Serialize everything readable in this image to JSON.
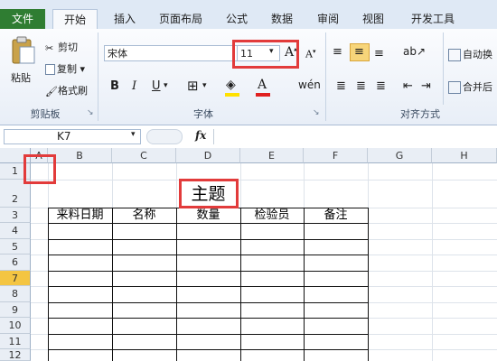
{
  "tabs": [
    {
      "label": "文件"
    },
    {
      "label": "开始"
    },
    {
      "label": "插入"
    },
    {
      "label": "页面布局"
    },
    {
      "label": "公式"
    },
    {
      "label": "数据"
    },
    {
      "label": "审阅"
    },
    {
      "label": "视图"
    },
    {
      "label": "开发工具"
    }
  ],
  "clipboard": {
    "paste_label": "粘贴",
    "cut_label": "剪切",
    "copy_label": "复制",
    "format_painter_label": "格式刷",
    "group_label": "剪贴板"
  },
  "font": {
    "name": "宋体",
    "size": "11",
    "group_label": "字体",
    "bold": "B",
    "italic": "I",
    "underline": "U"
  },
  "alignment": {
    "group_label": "对齐方式",
    "wrap_label": "自动换",
    "merge_label": "合并后"
  },
  "formula_bar": {
    "name_box": "K7",
    "fx": "fx",
    "content": ""
  },
  "columns": [
    "A",
    "B",
    "C",
    "D",
    "E",
    "F",
    "G",
    "H"
  ],
  "rows": [
    "1",
    "2",
    "3",
    "4",
    "5",
    "6",
    "7",
    "8",
    "9",
    "10",
    "11",
    "12"
  ],
  "sheet": {
    "title": "主题",
    "headers": [
      "来料日期",
      "名称",
      "数量",
      "检验员",
      "备注"
    ]
  },
  "colors": {
    "file_tab": "#2f7d32",
    "highlight_box": "#e23b3b",
    "selected_row": "#f4c542"
  }
}
